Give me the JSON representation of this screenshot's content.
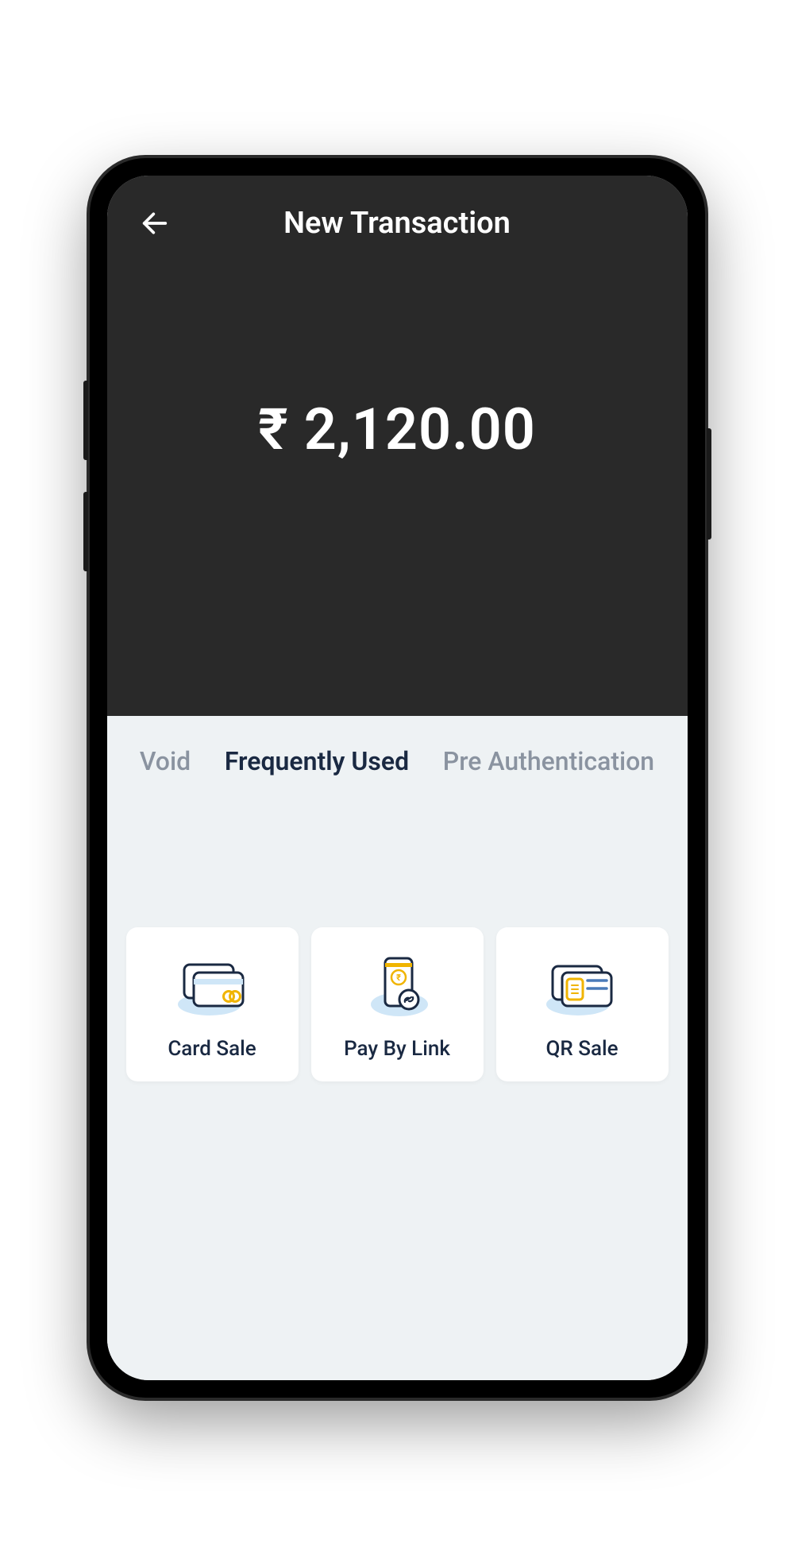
{
  "header": {
    "title": "New Transaction"
  },
  "amount": {
    "display": "₹ 2,120.00"
  },
  "tabs": [
    {
      "label": "Void",
      "active": false
    },
    {
      "label": "Frequently Used",
      "active": true
    },
    {
      "label": "Pre Authentication",
      "active": false
    }
  ],
  "options": [
    {
      "label": "Card Sale",
      "icon": "card-sale"
    },
    {
      "label": "Pay By Link",
      "icon": "pay-by-link"
    },
    {
      "label": "QR Sale",
      "icon": "qr-sale"
    }
  ]
}
